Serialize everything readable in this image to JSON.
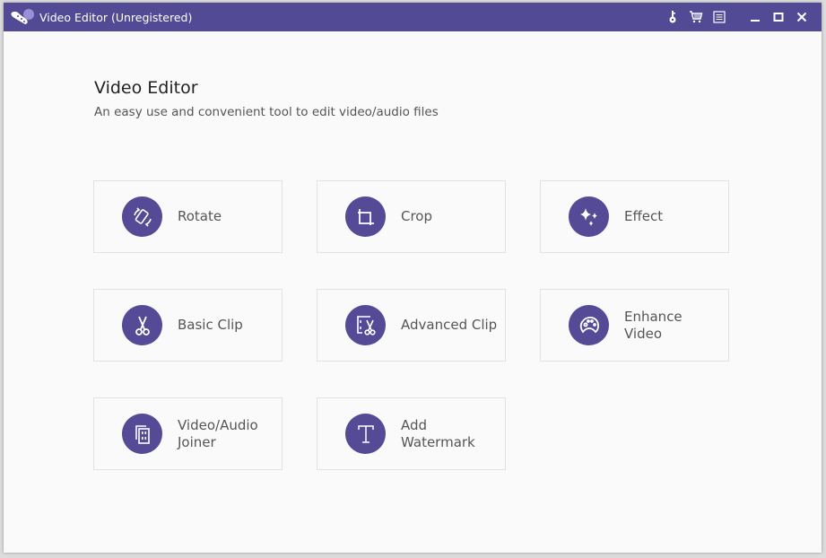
{
  "window": {
    "title": "Video Editor (Unregistered)",
    "titlebar_color": "#524a94",
    "controls": [
      {
        "name": "register-key-icon"
      },
      {
        "name": "cart-icon"
      },
      {
        "name": "feedback-list-icon"
      },
      {
        "name": "minimize-icon"
      },
      {
        "name": "maximize-icon"
      },
      {
        "name": "close-icon"
      }
    ]
  },
  "main": {
    "title": "Video Editor",
    "subtitle": "An easy use and convenient tool to edit video/audio files",
    "accent_color": "#554a96",
    "tools": [
      {
        "id": "rotate",
        "label": "Rotate",
        "icon": "rotate-icon"
      },
      {
        "id": "crop",
        "label": "Crop",
        "icon": "crop-icon"
      },
      {
        "id": "effect",
        "label": "Effect",
        "icon": "sparkles-icon"
      },
      {
        "id": "basic-clip",
        "label": "Basic Clip",
        "icon": "scissors-icon"
      },
      {
        "id": "advanced-clip",
        "label": "Advanced Clip",
        "icon": "film-scissors-icon"
      },
      {
        "id": "enhance-video",
        "label_line1": "Enhance",
        "label_line2": "Video",
        "icon": "palette-icon"
      },
      {
        "id": "joiner",
        "label_line1": "Video/Audio",
        "label_line2": "Joiner",
        "icon": "joiner-icon"
      },
      {
        "id": "watermark",
        "label_line1": "Add",
        "label_line2": "Watermark",
        "icon": "text-t-icon"
      }
    ]
  }
}
